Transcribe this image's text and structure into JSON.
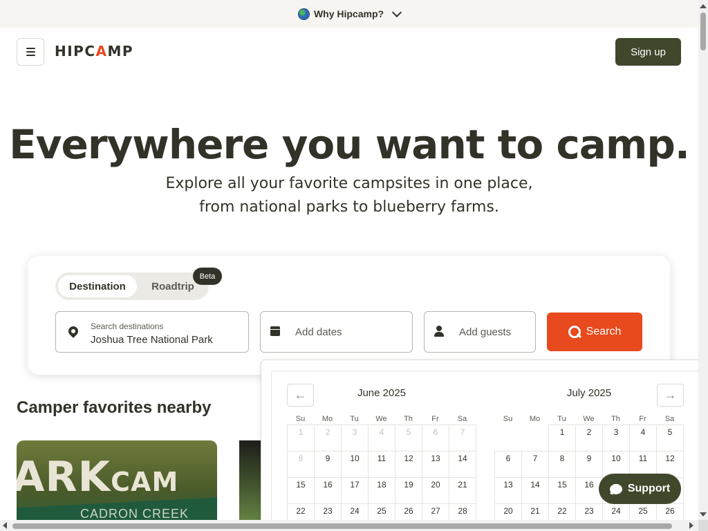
{
  "banner": {
    "label": "Why Hipcamp?"
  },
  "header": {
    "logo_before": "HIPC",
    "logo_a": "A",
    "logo_after": "MP",
    "signup_label": "Sign up"
  },
  "hero": {
    "title": "Everywhere you want to camp.",
    "subtitle_line1": "Explore all your favorite campsites in one place,",
    "subtitle_line2": "from national parks to blueberry farms."
  },
  "search": {
    "tabs": [
      {
        "label": "Destination",
        "selected": true
      },
      {
        "label": "Roadtrip",
        "selected": false
      }
    ],
    "beta_badge": "Beta",
    "destination_label": "Search destinations",
    "destination_value": "Joshua Tree National Park",
    "dates_placeholder": "Add dates",
    "guests_placeholder": "Add guests",
    "search_button": "Search"
  },
  "favorites": {
    "title": "Camper favorites nearby",
    "card1_sign_main": "ARK",
    "card1_sign_small": "CAM",
    "card1_sign_band": "CADRON CREEK"
  },
  "calendar": {
    "prev_icon": "←",
    "next_icon": "→",
    "weekdays": [
      "Su",
      "Mo",
      "Tu",
      "We",
      "Th",
      "Fr",
      "Sa"
    ],
    "months": [
      {
        "title": "June 2025",
        "leading_blanks": 0,
        "visible_days": 28,
        "disabled_through": 8
      },
      {
        "title": "July 2025",
        "leading_blanks": 2,
        "visible_days": 26,
        "disabled_through": 0
      }
    ]
  },
  "support": {
    "label": "Support"
  },
  "colors": {
    "accent": "#e8491d",
    "brand_dark": "#40482c",
    "text": "#323229"
  }
}
